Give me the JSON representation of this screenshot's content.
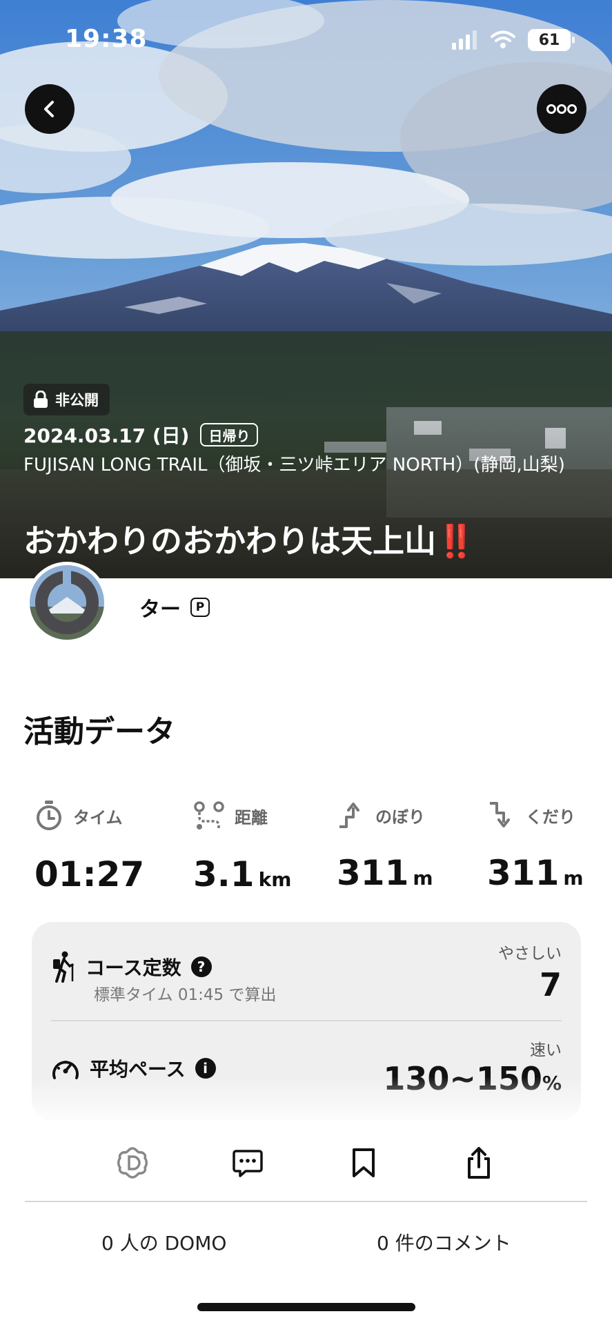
{
  "status_bar": {
    "time": "19:38",
    "battery": "61"
  },
  "hero": {
    "private_label": "非公開",
    "date": "2024.03.17 (日)",
    "day_trip_badge": "日帰り",
    "area": "FUJISAN LONG TRAIL（御坂・三ツ峠エリア NORTH）(静岡,山梨)",
    "title": "おかわりのおかわりは天上山",
    "title_emoji": "‼️"
  },
  "user": {
    "name": "ター",
    "badge": "P"
  },
  "activity": {
    "section_title": "活動データ",
    "stats": [
      {
        "icon": "stopwatch-icon",
        "label": "タイム",
        "value": "01:27",
        "unit": ""
      },
      {
        "icon": "route-icon",
        "label": "距離",
        "value": "3.1",
        "unit": "km"
      },
      {
        "icon": "ascent-icon",
        "label": "のぼり",
        "value": "311",
        "unit": "m"
      },
      {
        "icon": "descent-icon",
        "label": "くだり",
        "value": "311",
        "unit": "m"
      }
    ],
    "course_constant": {
      "label": "コース定数",
      "sub": "標準タイム 01:45 で算出",
      "rating": "やさしい",
      "value": "7"
    },
    "average_pace": {
      "label": "平均ペース",
      "rating": "速い",
      "value": "130~150",
      "unit": "%"
    }
  },
  "bottom": {
    "actions": [
      "domo-icon",
      "comment-icon",
      "bookmark-icon",
      "share-icon"
    ],
    "domo_count": "0 人の DOMO",
    "comment_count": "0 件のコメント"
  },
  "colors": {
    "accent_red": "#e53935",
    "card_bg": "#efefef"
  }
}
